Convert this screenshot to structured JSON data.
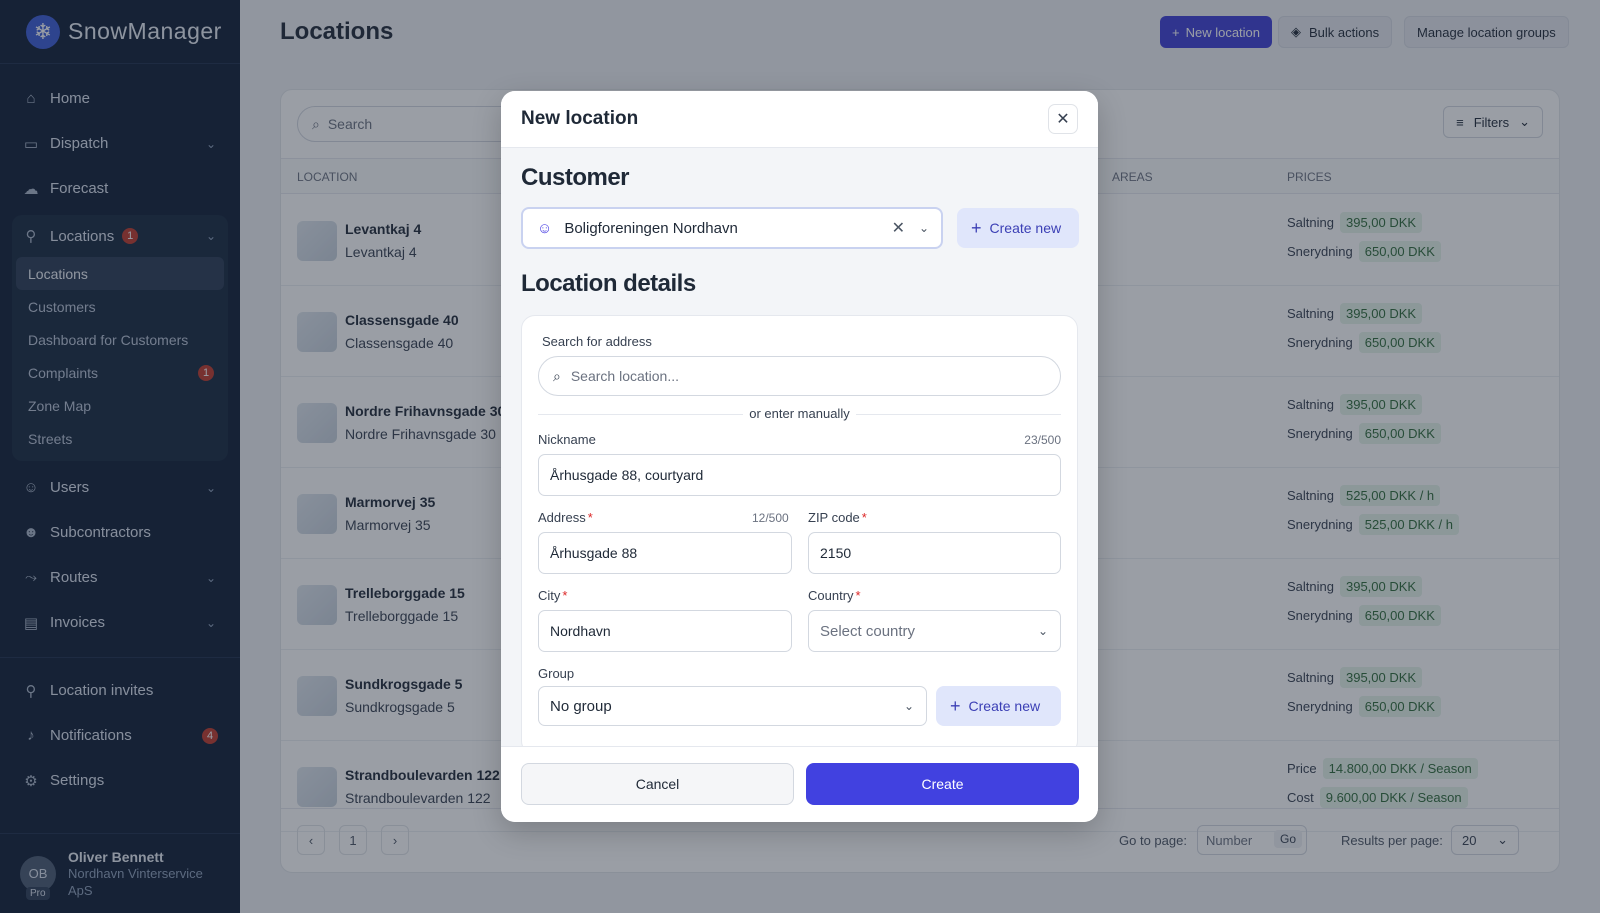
{
  "app": {
    "name": "SnowManager",
    "logo_icon": "snowflake-icon"
  },
  "sidebar": {
    "items": [
      {
        "label": "Home",
        "icon": "home-icon"
      },
      {
        "label": "Dispatch",
        "icon": "truck-icon"
      },
      {
        "label": "Forecast",
        "icon": "cloud-icon"
      }
    ],
    "locations_group": {
      "label": "Locations",
      "badge": "1",
      "sub": [
        {
          "label": "Locations"
        },
        {
          "label": "Customers"
        },
        {
          "label": "Dashboard for Customers"
        },
        {
          "label": "Complaints",
          "badge": "1"
        },
        {
          "label": "Zone Map"
        },
        {
          "label": "Streets"
        }
      ]
    },
    "items2": [
      {
        "label": "Users"
      },
      {
        "label": "Subcontractors"
      },
      {
        "label": "Routes"
      },
      {
        "label": "Invoices"
      }
    ],
    "bottom": [
      {
        "label": "Location invites"
      },
      {
        "label": "Notifications",
        "badge": "4"
      },
      {
        "label": "Settings"
      }
    ],
    "profile": {
      "initials": "OB",
      "tier": "Pro",
      "name": "Oliver Bennett",
      "org": "Nordhavn Vinterservice ApS"
    }
  },
  "header": {
    "title": "Locations",
    "new_location": "New location",
    "bulk_actions": "Bulk actions",
    "manage_groups": "Manage location groups"
  },
  "table": {
    "search_placeholder": "Search",
    "filters_label": "Filters",
    "columns": {
      "location": "LOCATION",
      "areas": "AREAS",
      "prices": "PRICES"
    },
    "rows": [
      {
        "title": "Levantkaj 4",
        "sub": "Levantkaj 4",
        "p1l": "Saltning",
        "p1v": "395,00 DKK",
        "p2l": "Snerydning",
        "p2v": "650,00 DKK"
      },
      {
        "title": "Classensgade 40",
        "sub": "Classensgade 40",
        "p1l": "Saltning",
        "p1v": "395,00 DKK",
        "p2l": "Snerydning",
        "p2v": "650,00 DKK"
      },
      {
        "title": "Nordre Frihavnsgade 30",
        "sub": "Nordre Frihavnsgade 30",
        "p1l": "Saltning",
        "p1v": "395,00 DKK",
        "p2l": "Snerydning",
        "p2v": "650,00 DKK"
      },
      {
        "title": "Marmorvej 35",
        "sub": "Marmorvej 35",
        "p1l": "Saltning",
        "p1v": "525,00 DKK / h",
        "p2l": "Snerydning",
        "p2v": "525,00 DKK / h"
      },
      {
        "title": "Trelleborggade 15",
        "sub": "Trelleborggade 15",
        "p1l": "Saltning",
        "p1v": "395,00 DKK",
        "p2l": "Snerydning",
        "p2v": "650,00 DKK"
      },
      {
        "title": "Sundkrogsgade 5",
        "sub": "Sundkrogsgade 5",
        "p1l": "Saltning",
        "p1v": "395,00 DKK",
        "p2l": "Snerydning",
        "p2v": "650,00 DKK"
      },
      {
        "title": "Strandboulevarden 122",
        "sub": "Strandboulevarden 122",
        "p1l": "Price",
        "p1v": "14.800,00 DKK / Season",
        "p2l": "Cost",
        "p2v": "9.600,00 DKK / Season"
      }
    ],
    "pager": {
      "page": "1",
      "goto_label": "Go to page:",
      "goto_placeholder": "Number",
      "go": "Go",
      "per_page_label": "Results per page:",
      "per_page": "20"
    }
  },
  "modal": {
    "title": "New location",
    "customer_heading": "Customer",
    "customer_value": "Boligforeningen Nordhavn",
    "create_new": "Create new",
    "details_heading": "Location details",
    "search_label": "Search for address",
    "search_placeholder": "Search location...",
    "or_manual": "or enter manually",
    "nickname_label": "Nickname",
    "nickname_count": "23/500",
    "nickname_value": "Århusgade 88, courtyard",
    "address_label": "Address",
    "address_count": "12/500",
    "address_value": "Århusgade 88",
    "zip_label": "ZIP code",
    "zip_value": "2150",
    "city_label": "City",
    "city_value": "Nordhavn",
    "country_label": "Country",
    "country_placeholder": "Select country",
    "group_label": "Group",
    "group_value": "No group",
    "group_create_new": "Create new",
    "cancel": "Cancel",
    "create": "Create"
  }
}
